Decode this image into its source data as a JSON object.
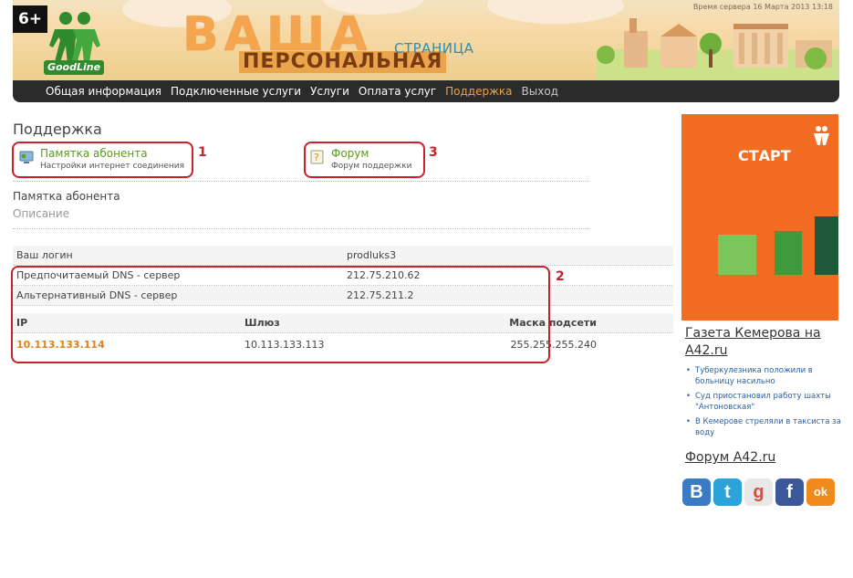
{
  "header": {
    "age_rating": "6+",
    "logo_text": "GoodLine",
    "title_main": "ВАША",
    "title_sub": "ПЕРСОНАЛЬНАЯ",
    "title_small": "СТРАНИЦА",
    "server_time": "Время сервера 16 Марта 2013 13:18"
  },
  "nav": {
    "items": [
      {
        "label": "Общая информация"
      },
      {
        "label": "Подключенные услуги"
      },
      {
        "label": "Услуги"
      },
      {
        "label": "Оплата услуг"
      },
      {
        "label": "Поддержка"
      },
      {
        "label": "Выход"
      }
    ]
  },
  "page": {
    "title": "Поддержка",
    "cards": [
      {
        "title": "Памятка абонента",
        "desc": "Настройки интернет соединения",
        "number": "1",
        "icon": "network-settings-icon"
      },
      {
        "title": "Форум",
        "desc": "Форум поддержки",
        "number": "3",
        "icon": "forum-icon"
      }
    ],
    "memo_title": "Памятка абонента",
    "memo_desc": "Описание",
    "highlight_number": "2",
    "info_rows": [
      {
        "key": "Ваш логин",
        "value": "prodluks3"
      },
      {
        "key": "Предпочитаемый DNS - сервер",
        "value": "212.75.210.62"
      },
      {
        "key": "Альтернативный DNS - сервер",
        "value": "212.75.211.2"
      }
    ],
    "ip_headers": {
      "ip": "IP",
      "gateway": "Шлюз",
      "mask": "Маска подсети"
    },
    "ip_values": {
      "ip": "10.113.133.114",
      "gateway": "10.113.133.113",
      "mask": "255.255.255.240"
    }
  },
  "sidebar": {
    "ad_text": "СТАРТ",
    "news_title": "Газета Кемерова на A42.ru",
    "news_items": [
      "Туберкулезника положили в больницу насильно",
      "Суд приостановил работу шахты \"Антоновская\"",
      "В Кемерове стреляли в таксиста за воду"
    ],
    "forum_link": "Форум A42.ru",
    "social": [
      {
        "label": "В",
        "icon": "vkontakte-icon",
        "color": "#3b7bc4"
      },
      {
        "label": "t",
        "icon": "twitter-icon",
        "color": "#2aa3d8"
      },
      {
        "label": "g",
        "icon": "google-icon",
        "color": "#e8e8e8"
      },
      {
        "label": "f",
        "icon": "facebook-icon",
        "color": "#3b5998"
      },
      {
        "label": "ok",
        "icon": "odnoklassniki-icon",
        "color": "#f08a1c"
      }
    ]
  },
  "colors": {
    "accent": "#f0a03c",
    "highlight": "#c9222a",
    "link_green": "#5a9a1e",
    "ad_orange": "#f26d21"
  }
}
